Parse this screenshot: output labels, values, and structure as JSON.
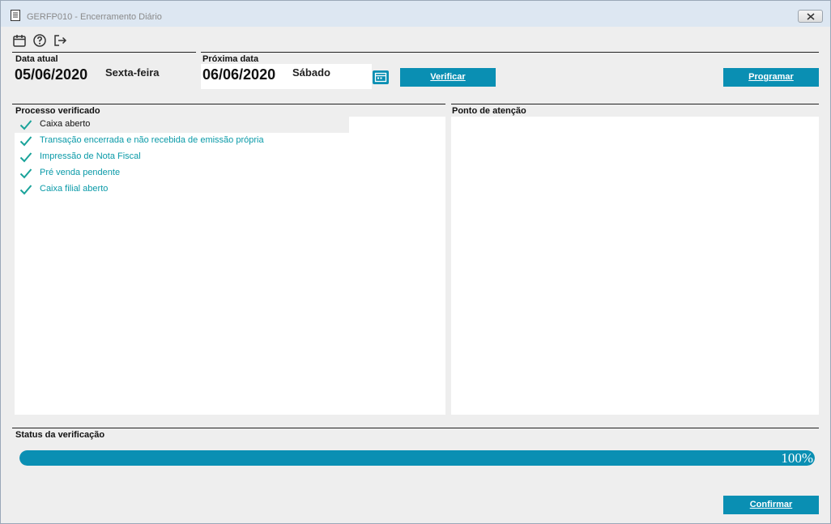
{
  "window": {
    "title": "GERFP010 - Encerramento Diário"
  },
  "toolbar": {
    "icons": [
      "calendar-icon",
      "help-icon",
      "exit-icon"
    ]
  },
  "current_date": {
    "label": "Data atual",
    "date": "05/06/2020",
    "weekday": "Sexta-feira"
  },
  "next_date": {
    "label": "Próxima data",
    "date": "06/06/2020",
    "weekday": "Sábado"
  },
  "buttons": {
    "verify": "Verificar",
    "schedule": "Programar",
    "confirm": "Confirmar"
  },
  "processes": {
    "header": "Processo verificado",
    "items": [
      "Caixa aberto",
      "Transação encerrada e não recebida de emissão própria",
      "Impressão de Nota Fiscal",
      "Pré venda pendente",
      "Caixa filial aberto"
    ]
  },
  "attention": {
    "header": "Ponto de atenção"
  },
  "status": {
    "header": "Status da verificação",
    "progress_label": "100%",
    "progress_fraction": 1.0
  },
  "colors": {
    "accent": "#0a8fb3",
    "check": "#1aa39a",
    "item_text": "#0a9aa8"
  }
}
